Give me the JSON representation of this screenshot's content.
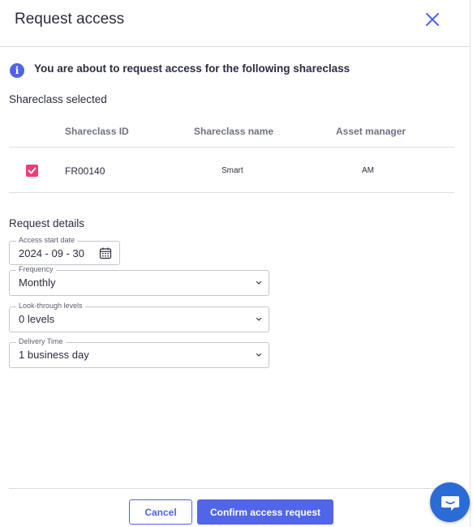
{
  "modal": {
    "title": "Request access",
    "close_icon": "close-icon"
  },
  "info": {
    "icon": "info-icon",
    "text": "You are about to request access for the following shareclass"
  },
  "shareclass": {
    "section_title": "Shareclass selected",
    "columns": [
      "Shareclass ID",
      "Shareclass name",
      "Asset manager"
    ],
    "rows": [
      {
        "checked": true,
        "id": "FR00140",
        "name": "Smart",
        "asset_manager": "AM"
      }
    ]
  },
  "request_details": {
    "section_title": "Request details",
    "access_start_date": {
      "label": "Access start date",
      "value": "2024 - 09 - 30",
      "icon": "calendar-icon"
    },
    "frequency": {
      "label": "Frequency",
      "value": "Monthly"
    },
    "look_through": {
      "label": "Look-through levels",
      "value": "0 levels"
    },
    "delivery_time": {
      "label": "Delivery Time",
      "value": "1 business day"
    }
  },
  "footer": {
    "cancel_label": "Cancel",
    "confirm_label": "Confirm access request"
  },
  "chat": {
    "icon": "chat-bubble-icon"
  },
  "colors": {
    "accent": "#4f63e8",
    "checkbox": "#ec3d7a",
    "chat": "#2b6bd6",
    "text": "#2b2d42",
    "muted": "#6f7285"
  }
}
